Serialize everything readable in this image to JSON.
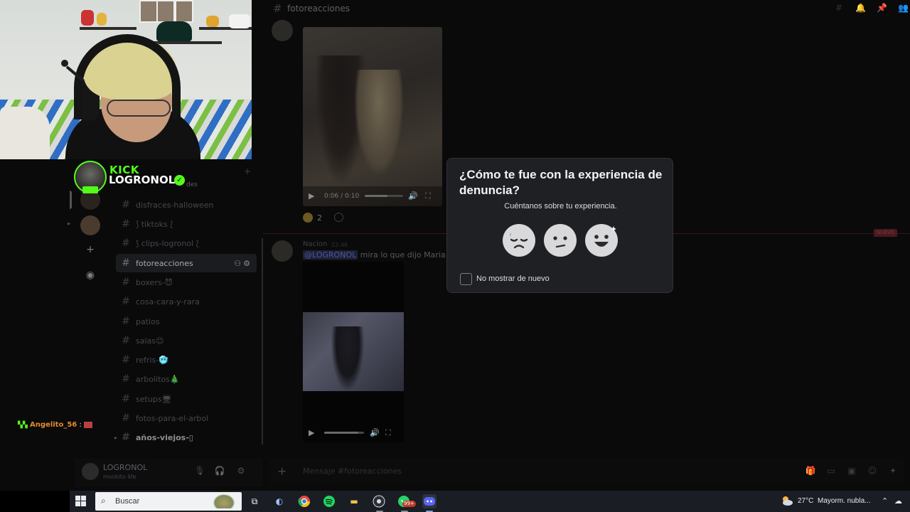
{
  "discord": {
    "channel_title": "fotoreacciones",
    "channels": [
      {
        "name": "disfraces-halloween"
      },
      {
        "name": "⟆ tiktoks ⟅"
      },
      {
        "name": "⟆ clips-logronol ⟅"
      },
      {
        "name": "fotoreacciones",
        "active": true
      },
      {
        "name": "boxers-😈"
      },
      {
        "name": "cosa-cara-y-rara"
      },
      {
        "name": "patios"
      },
      {
        "name": "salas😊"
      },
      {
        "name": "refris-🥶"
      },
      {
        "name": "arbolitos🎄"
      },
      {
        "name": "setups🖥"
      },
      {
        "name": "fotos-para-el-arbol"
      },
      {
        "name": "años-viejos-▯"
      }
    ],
    "partial_label": "des",
    "user": {
      "name": "LOGRONOL",
      "status": "moskito life"
    },
    "message1": {
      "video_time": "0:06 / 0:10",
      "progress": 0.6,
      "reaction_count": "2"
    },
    "new_badge": "NUEVO",
    "message2": {
      "author": "Nacion",
      "time": "22:46",
      "mention": "@LOGRONOL",
      "text": " mira lo que dijo Maria desp",
      "progress": 0.85
    },
    "composer_placeholder": "Mensaje #fotoreacciones"
  },
  "overlay": {
    "kick_word": "KICK",
    "streamer": "LOGRONOL",
    "chat": {
      "user": "Angelito_56",
      "separator": ":"
    }
  },
  "modal": {
    "title": "¿Cómo te fue con la experiencia de denuncia?",
    "subtitle": "Cuéntanos sobre tu experiencia.",
    "faces": [
      "sad-face",
      "neutral-face",
      "happy-face"
    ],
    "checkbox_label": "No mostrar de nuevo",
    "checkbox_checked": false
  },
  "taskbar": {
    "search_placeholder": "Buscar",
    "badge_count": "99+",
    "weather_temp": "27°C",
    "weather_desc": "Mayorm. nubla..."
  },
  "colors": {
    "kick_green": "#53fc18",
    "modal_bg": "#1f2023",
    "new_red": "#4a1a1e"
  }
}
